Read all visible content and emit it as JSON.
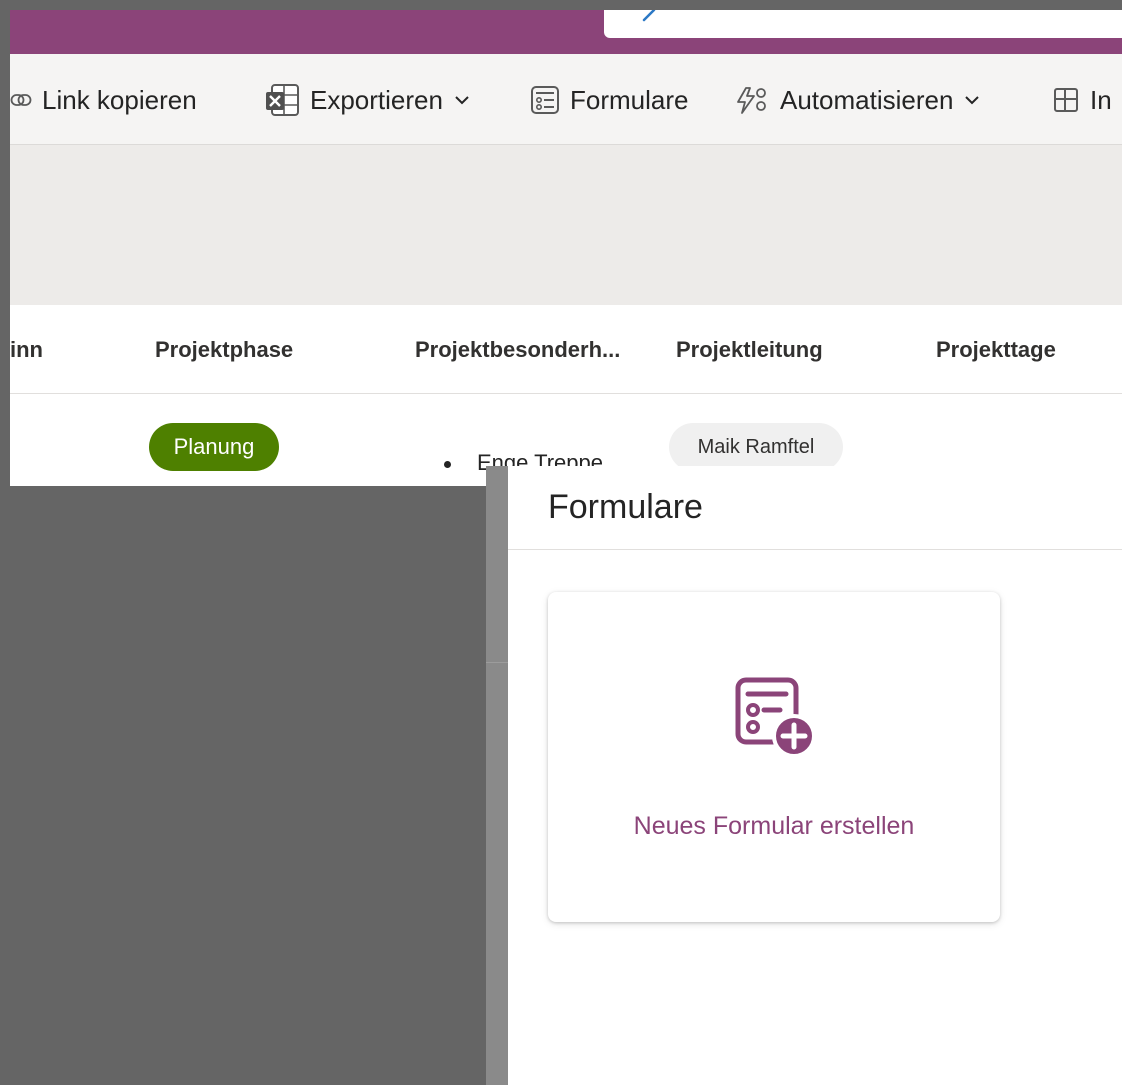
{
  "commandbar": {
    "items": [
      {
        "label": "Link kopieren",
        "icon": "link-icon"
      },
      {
        "label": "Exportieren",
        "icon": "excel-icon",
        "has_dropdown": true
      },
      {
        "label": "Formulare",
        "icon": "form-icon"
      },
      {
        "label": "Automatisieren",
        "icon": "automate-icon",
        "has_dropdown": true
      },
      {
        "label": "In",
        "icon": "integrate-icon"
      }
    ]
  },
  "grid": {
    "columns": [
      "inn",
      "Projektphase",
      "Projektbesonderh...",
      "Projektleitung",
      "Projekttage"
    ],
    "row": {
      "projektphase": "Planung",
      "projektleitung": "Maik Ramftel",
      "besonderheit_partial": "Enge Treppe"
    }
  },
  "dialog": {
    "title": "Formulare",
    "new_form_label": "Neues Formular erstellen"
  },
  "colors": {
    "brand": "#8b4479",
    "phase_pill": "#4e8000",
    "person_pill": "#f0f0f0"
  }
}
